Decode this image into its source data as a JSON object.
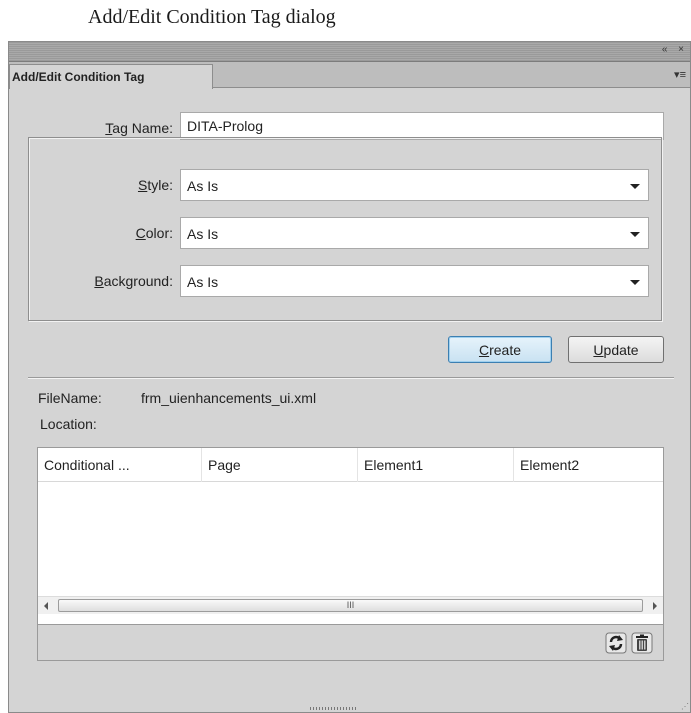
{
  "caption": "Add/Edit Condition Tag dialog",
  "panel": {
    "tab_label": "Add/Edit Condition Tag",
    "titlebar_icons": "« ×",
    "menu_icon": "▾≡"
  },
  "form": {
    "tag_name": {
      "mnemonic": "T",
      "rest": "ag Name:",
      "value": "DITA-Prolog"
    },
    "style": {
      "mnemonic": "S",
      "rest": "tyle:",
      "value": "As Is"
    },
    "color": {
      "mnemonic": "C",
      "rest": "olor:",
      "value": "As Is"
    },
    "background": {
      "mnemonic": "B",
      "rest": "ackground:",
      "value": "As Is"
    }
  },
  "buttons": {
    "create": {
      "mnemonic": "C",
      "rest": "reate"
    },
    "update": {
      "mnemonic": "U",
      "rest": "pdate"
    }
  },
  "info": {
    "filename_label": "FileName:",
    "filename_value": "frm_uienhancements_ui.xml",
    "location_label": "Location:"
  },
  "table": {
    "columns": [
      "Conditional ...",
      "Page",
      "Element1",
      "Element2"
    ],
    "rows": [],
    "scroll_thumb": "III"
  },
  "icons": [
    "refresh-icon",
    "trash-icon"
  ]
}
